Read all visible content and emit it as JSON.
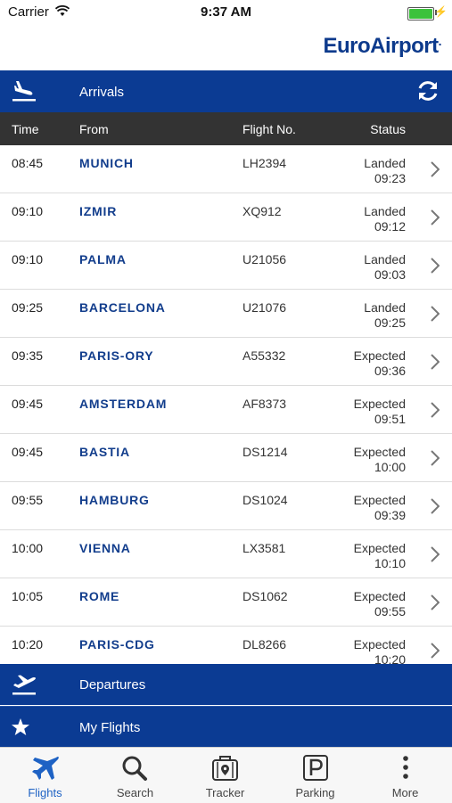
{
  "status_bar": {
    "carrier": "Carrier",
    "time": "9:37 AM"
  },
  "brand": {
    "logo_part1": "Euro",
    "logo_part2": "Airport",
    "logo_mark": "."
  },
  "arrivals": {
    "title": "Arrivals"
  },
  "columns": {
    "time": "Time",
    "from": "From",
    "flight": "Flight No.",
    "status": "Status"
  },
  "flights": [
    {
      "time": "08:45",
      "from": "MUNICH",
      "flight": "LH2394",
      "status": "Landed",
      "status_time": "09:23"
    },
    {
      "time": "09:10",
      "from": "IZMIR",
      "flight": "XQ912",
      "status": "Landed",
      "status_time": "09:12"
    },
    {
      "time": "09:10",
      "from": "PALMA",
      "flight": "U21056",
      "status": "Landed",
      "status_time": "09:03"
    },
    {
      "time": "09:25",
      "from": "BARCELONA",
      "flight": "U21076",
      "status": "Landed",
      "status_time": "09:25"
    },
    {
      "time": "09:35",
      "from": "PARIS-ORY",
      "flight": "A55332",
      "status": "Expected",
      "status_time": "09:36"
    },
    {
      "time": "09:45",
      "from": "AMSTERDAM",
      "flight": "AF8373",
      "status": "Expected",
      "status_time": "09:51"
    },
    {
      "time": "09:45",
      "from": "BASTIA",
      "flight": "DS1214",
      "status": "Expected",
      "status_time": "10:00"
    },
    {
      "time": "09:55",
      "from": "HAMBURG",
      "flight": "DS1024",
      "status": "Expected",
      "status_time": "09:39"
    },
    {
      "time": "10:00",
      "from": "VIENNA",
      "flight": "LX3581",
      "status": "Expected",
      "status_time": "10:10"
    },
    {
      "time": "10:05",
      "from": "ROME",
      "flight": "DS1062",
      "status": "Expected",
      "status_time": "09:55"
    },
    {
      "time": "10:20",
      "from": "PARIS-CDG",
      "flight": "DL8266",
      "status": "Expected",
      "status_time": "10:20"
    }
  ],
  "departures": {
    "title": "Departures"
  },
  "my_flights": {
    "title": "My Flights"
  },
  "tabs": [
    {
      "label": "Flights",
      "icon": "airplane-icon",
      "active": true
    },
    {
      "label": "Search",
      "icon": "search-icon",
      "active": false
    },
    {
      "label": "Tracker",
      "icon": "luggage-tracker-icon",
      "active": false
    },
    {
      "label": "Parking",
      "icon": "parking-icon",
      "active": false
    },
    {
      "label": "More",
      "icon": "more-dots-icon",
      "active": false
    }
  ],
  "colors": {
    "brand_blue": "#0b3b93",
    "header_dark": "#333333",
    "tab_active": "#1e62c4"
  }
}
